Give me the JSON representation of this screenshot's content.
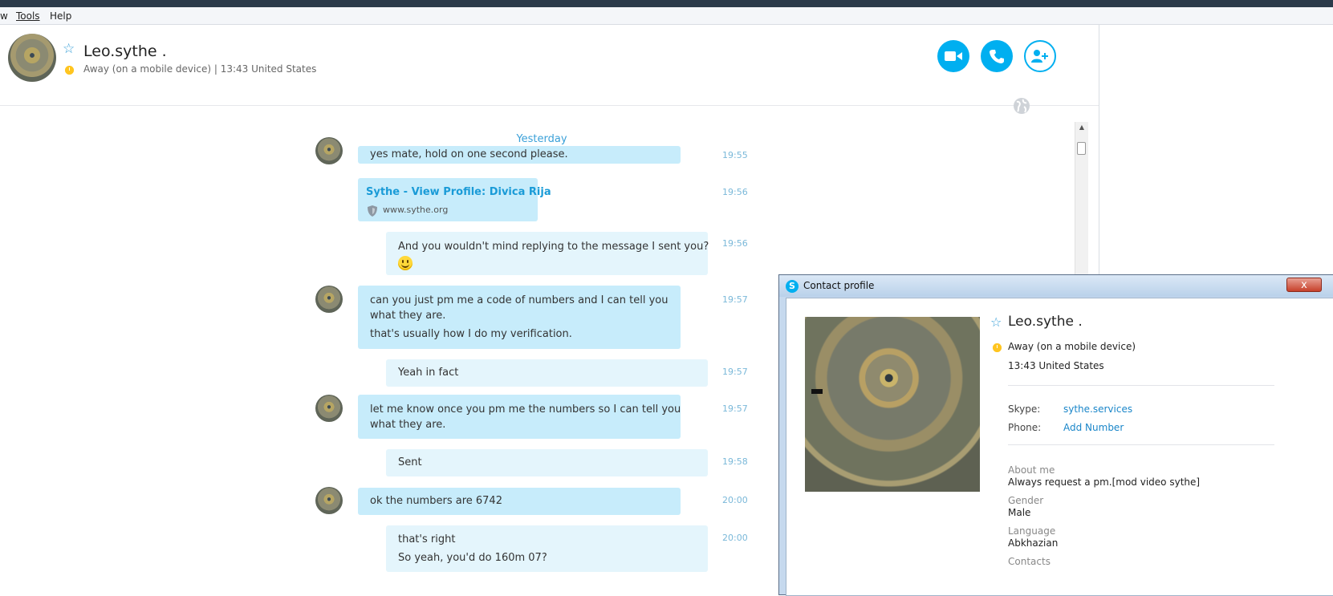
{
  "menubar": {
    "items": [
      "w",
      "Tools",
      "Help"
    ]
  },
  "header": {
    "contact_name": "Leo.sythe .",
    "status": "Away (on a mobile device)",
    "local_time": "| 13:43 United States"
  },
  "chat": {
    "day_label": "Yesterday",
    "messages": [
      {
        "dir": "in",
        "text": [
          "yes mate, hold on one second please."
        ],
        "time": "19:55"
      },
      {
        "dir": "in",
        "link_title": "Sythe - View Profile: Divica Rija",
        "link_url": "www.sythe.org",
        "time": "19:56"
      },
      {
        "dir": "out",
        "text": [
          "And you wouldn't mind replying to the message I sent you?"
        ],
        "time": "19:56"
      },
      {
        "dir": "in",
        "text": [
          "can you just pm me a code of numbers and I can tell you",
          "what they are.",
          "that's usually how I do my verification."
        ],
        "time": "19:57"
      },
      {
        "dir": "out",
        "text": [
          "Yeah in fact"
        ],
        "time": "19:57"
      },
      {
        "dir": "in",
        "text": [
          "let me know once you pm me the numbers so I can tell you",
          "what they are."
        ],
        "time": "19:57"
      },
      {
        "dir": "out",
        "text": [
          "Sent"
        ],
        "time": "19:58"
      },
      {
        "dir": "in",
        "text": [
          "ok the numbers are 6742"
        ],
        "time": "20:00"
      },
      {
        "dir": "out",
        "text": [
          "that's right",
          "So yeah, you'd do 160m 07?"
        ],
        "time": "20:00"
      }
    ]
  },
  "profile": {
    "window_title": "Contact profile",
    "close": "x",
    "name": "Leo.sythe .",
    "status": "Away (on a mobile device)",
    "local_time": "13:43 United States",
    "skype_label": "Skype:",
    "skype_value": "sythe.services",
    "phone_label": "Phone:",
    "phone_value": "Add Number",
    "about_label": "About me",
    "about_value": "Always request a pm.[mod video sythe]",
    "gender_label": "Gender",
    "gender_value": "Male",
    "language_label": "Language",
    "language_value": "Abkhazian",
    "contacts_label": "Contacts"
  },
  "icons": {
    "favorite": "star-outline-icon",
    "video_call": "video-camera-icon",
    "audio_call": "phone-icon",
    "add_people": "add-person-icon",
    "accent": "#00aff0"
  }
}
